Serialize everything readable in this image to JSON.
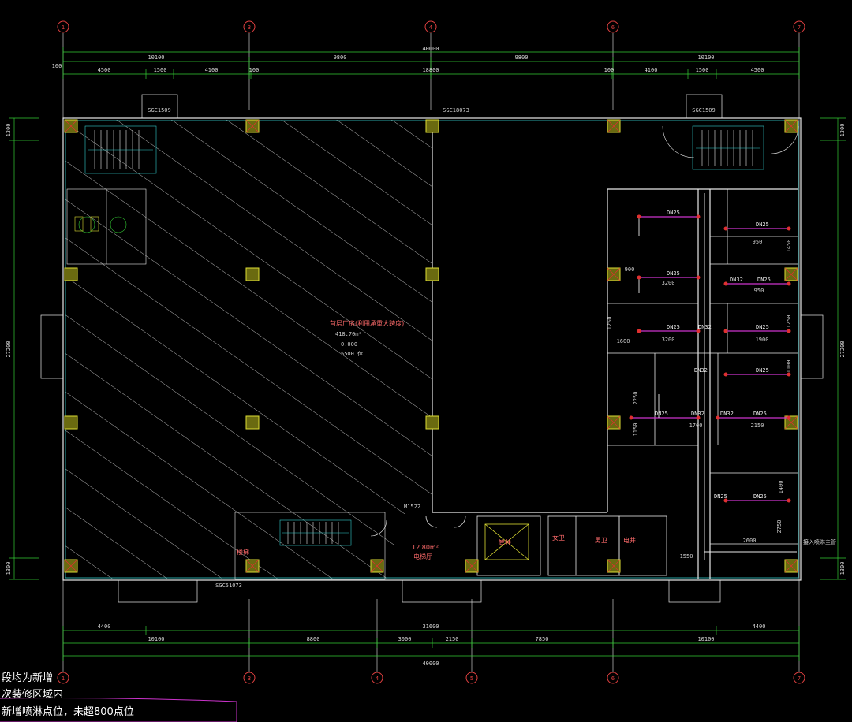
{
  "axes": {
    "top": [
      "1",
      "3",
      "4",
      "6",
      "7"
    ],
    "bottom": [
      "1",
      "3",
      "4",
      "5",
      "6",
      "7"
    ]
  },
  "dims_top": {
    "total": "40000",
    "row1": [
      "10100",
      "9800",
      "9800",
      "10100"
    ],
    "row2": [
      "4500",
      "1500",
      "4100",
      "100",
      "18800",
      "100",
      "4100",
      "1500",
      "4500"
    ],
    "left_offset": "100"
  },
  "dims_bottom": {
    "row1": [
      "4400",
      "31600",
      "4400"
    ],
    "row2": [
      "10100",
      "8800",
      "3000",
      "2150",
      "7850",
      "10100"
    ],
    "total": "40000"
  },
  "dims_side": {
    "left": [
      "1300",
      "27200",
      "1300"
    ],
    "right": [
      "1300",
      "27200",
      "1300"
    ]
  },
  "windows": {
    "top_left": "SGC1509",
    "top_center": "SGC18073",
    "top_right": "SGC1509",
    "bottom_left": "SGC51073"
  },
  "hatched_area": {
    "title": "首层厂房(利用承重大跨度)",
    "area": "418.70m²",
    "elevation": "0.000",
    "subtext": "5500 休"
  },
  "labels": {
    "door_m": "M1522",
    "lift_area": "12.80m²",
    "lift_room": "电梯厅",
    "shaft": "管井",
    "stair_room": "楼梯",
    "women_wc": "女卫",
    "men_wc": "男卫",
    "elec": "电井",
    "pipe_main": "接入喷淋主管"
  },
  "pipes": [
    "DN25",
    "DN25",
    "DN25",
    "DN25",
    "DN32",
    "DN25",
    "DN25",
    "DN32",
    "DN25",
    "DN32",
    "DN25",
    "DN32",
    "DN25",
    "DN32",
    "DN25",
    "DN25"
  ],
  "room_dims": [
    "950",
    "950",
    "1450",
    "3200",
    "3200",
    "1600",
    "1900",
    "1250",
    "1250",
    "1100",
    "2250",
    "1700",
    "2150",
    "1150",
    "1400",
    "2750",
    "2600",
    "1550",
    "900"
  ],
  "notes": [
    "段均为新增",
    "次装修区域内",
    "新增喷淋点位，未超800点位"
  ],
  "colors": {
    "grid": "#ffffff",
    "dim": "#33cc33",
    "wall": "#e8e8e8",
    "column": "#c8c832",
    "hatch": "#cfcfcf",
    "pipe": "#cc33cc",
    "cyan": "#33cccc",
    "red": "#e03030",
    "yellow": "#dddd33"
  }
}
